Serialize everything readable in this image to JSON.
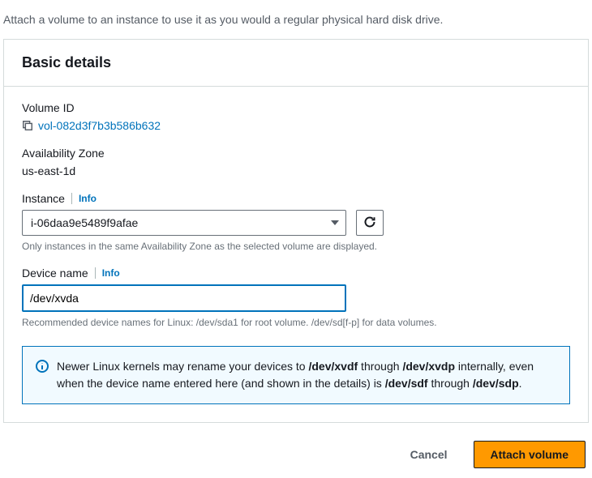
{
  "page": {
    "description": "Attach a volume to an instance to use it as you would a regular physical hard disk drive."
  },
  "card": {
    "title": "Basic details"
  },
  "volumeId": {
    "label": "Volume ID",
    "value": "vol-082d3f7b3b586b632"
  },
  "availabilityZone": {
    "label": "Availability Zone",
    "value": "us-east-1d"
  },
  "instance": {
    "label": "Instance",
    "info": "Info",
    "selected": "i-06daa9e5489f9afae",
    "help": "Only instances in the same Availability Zone as the selected volume are displayed."
  },
  "deviceName": {
    "label": "Device name",
    "info": "Info",
    "value": "/dev/xvda",
    "help": "Recommended device names for Linux: /dev/sda1 for root volume. /dev/sd[f-p] for data volumes."
  },
  "infoBox": {
    "prefix": "Newer Linux kernels may rename your devices to ",
    "b1": "/dev/xvdf",
    "mid1": " through ",
    "b2": "/dev/xvdp",
    "mid2": " internally, even when the device name entered here (and shown in the details) is ",
    "b3": "/dev/sdf",
    "mid3": " through ",
    "b4": "/dev/sdp",
    "suffix": "."
  },
  "footer": {
    "cancel": "Cancel",
    "submit": "Attach volume"
  }
}
